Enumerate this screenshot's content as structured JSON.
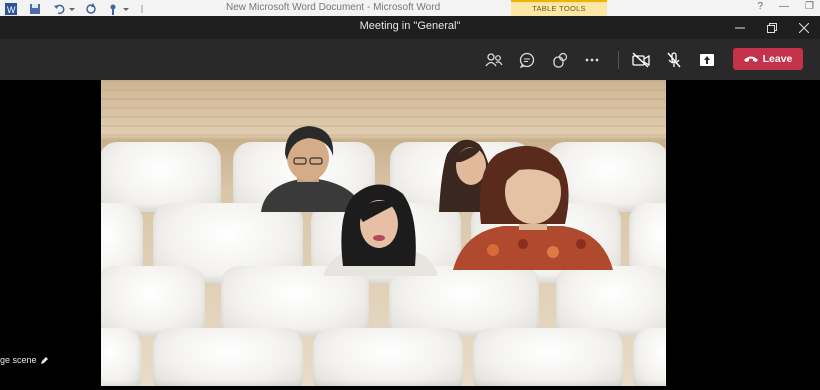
{
  "word": {
    "document_title": "New Microsoft Word Document - Microsoft Word",
    "context_tab": "TABLE TOOLS",
    "help": "?"
  },
  "window": {
    "title": "Meeting in \"General\""
  },
  "toolbar": {
    "icons": [
      "people-icon",
      "chat-icon",
      "reactions-icon",
      "more-icon",
      "camera-off-icon",
      "mic-off-icon",
      "share-icon"
    ],
    "leave_label": "Leave",
    "leave_color": "#c4314b"
  },
  "stage": {
    "caption": "ge scene"
  }
}
